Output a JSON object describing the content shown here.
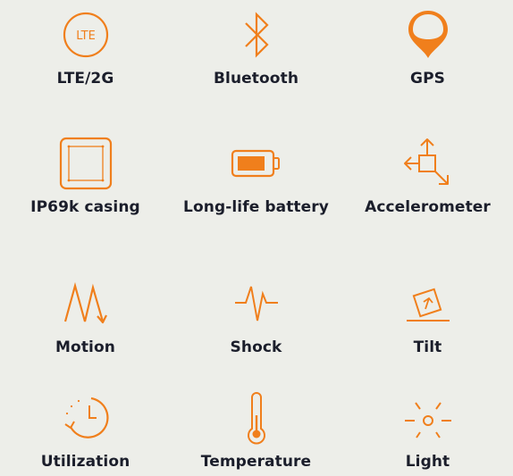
{
  "accent_color": "#F07F1C",
  "label_color": "#1B1E2B",
  "features": [
    {
      "label": "LTE/2G",
      "icon": "lte-circle-icon",
      "badge": "LTE"
    },
    {
      "label": "Bluetooth",
      "icon": "bluetooth-icon"
    },
    {
      "label": "GPS",
      "icon": "gps-pin-icon"
    },
    {
      "label": "IP69k casing",
      "icon": "casing-box-icon"
    },
    {
      "label": "Long-life battery",
      "icon": "battery-icon"
    },
    {
      "label": "Accelerometer",
      "icon": "accelerometer-icon"
    },
    {
      "label": "Motion",
      "icon": "motion-zigzag-icon"
    },
    {
      "label": "Shock",
      "icon": "shock-pulse-icon"
    },
    {
      "label": "Tilt",
      "icon": "tilt-icon"
    },
    {
      "label": "Utilization",
      "icon": "utilization-clock-icon"
    },
    {
      "label": "Temperature",
      "icon": "thermometer-icon"
    },
    {
      "label": "Light",
      "icon": "light-sun-icon"
    }
  ]
}
